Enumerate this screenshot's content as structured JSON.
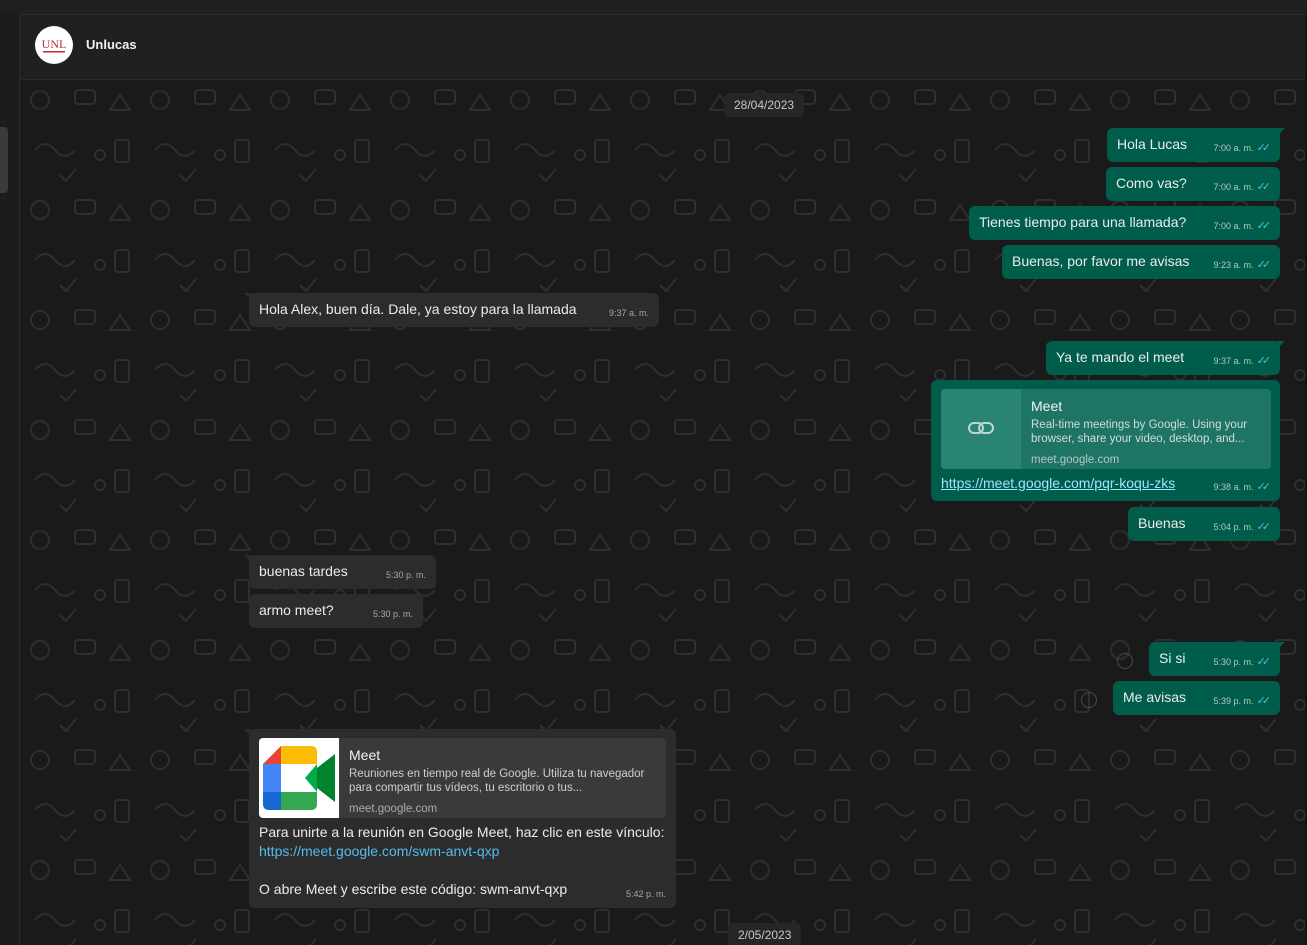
{
  "contact": {
    "name": "Unlucas",
    "avatar_text": "UNL"
  },
  "dates": {
    "first": "28/04/2023",
    "second": "2/05/2023"
  },
  "messages": {
    "m1": {
      "text": "Hola Lucas",
      "time": "7:00 a. m."
    },
    "m2": {
      "text": "Como vas?",
      "time": "7:00 a. m."
    },
    "m3": {
      "text": "Tienes tiempo para una llamada?",
      "time": "7:00 a. m."
    },
    "m4": {
      "text": "Buenas, por favor me avisas",
      "time": "9:23 a. m."
    },
    "m5": {
      "text": "Hola Alex, buen día. Dale, ya estoy para la llamada",
      "time": "9:37 a. m."
    },
    "m6": {
      "text": "Ya te mando el meet",
      "time": "9:37 a. m."
    },
    "m7": {
      "preview_title": "Meet",
      "preview_desc_1": "Real-time meetings by Google. Using your",
      "preview_desc_2": "browser, share your video, desktop, and...",
      "preview_domain": "meet.google.com",
      "link": "https://meet.google.com/pqr-koqu-zks",
      "time": "9:38 a. m."
    },
    "m8": {
      "text": "Buenas",
      "time": "5:04 p. m."
    },
    "m9": {
      "text": "buenas tardes",
      "time": "5:30 p. m."
    },
    "m10": {
      "text": "armo meet?",
      "time": "5:30 p. m."
    },
    "m11": {
      "text": "Si si",
      "time": "5:30 p. m."
    },
    "m12": {
      "text": "Me avisas",
      "time": "5:39 p. m."
    },
    "m13": {
      "preview_title": "Meet",
      "preview_desc_1": "Reuniones en tiempo real de Google. Utiliza tu navegador",
      "preview_desc_2": "para compartir tus vídeos, tu escritorio o tus...",
      "preview_domain": "meet.google.com",
      "line1": "Para unirte a la reunión en Google Meet, haz clic en este vínculo:",
      "link": "https://meet.google.com/swm-anvt-qxp",
      "line3": "O abre Meet y escribe este código: swm-anvt-qxp",
      "time": "5:42 p. m."
    }
  },
  "colors": {
    "outgoing": "#005c4b",
    "incoming": "#2c2c2c",
    "read_tick": "#53bdeb"
  },
  "icons": {
    "read": "double-check-icon",
    "emoji": "smiley-icon",
    "link": "link-icon"
  }
}
